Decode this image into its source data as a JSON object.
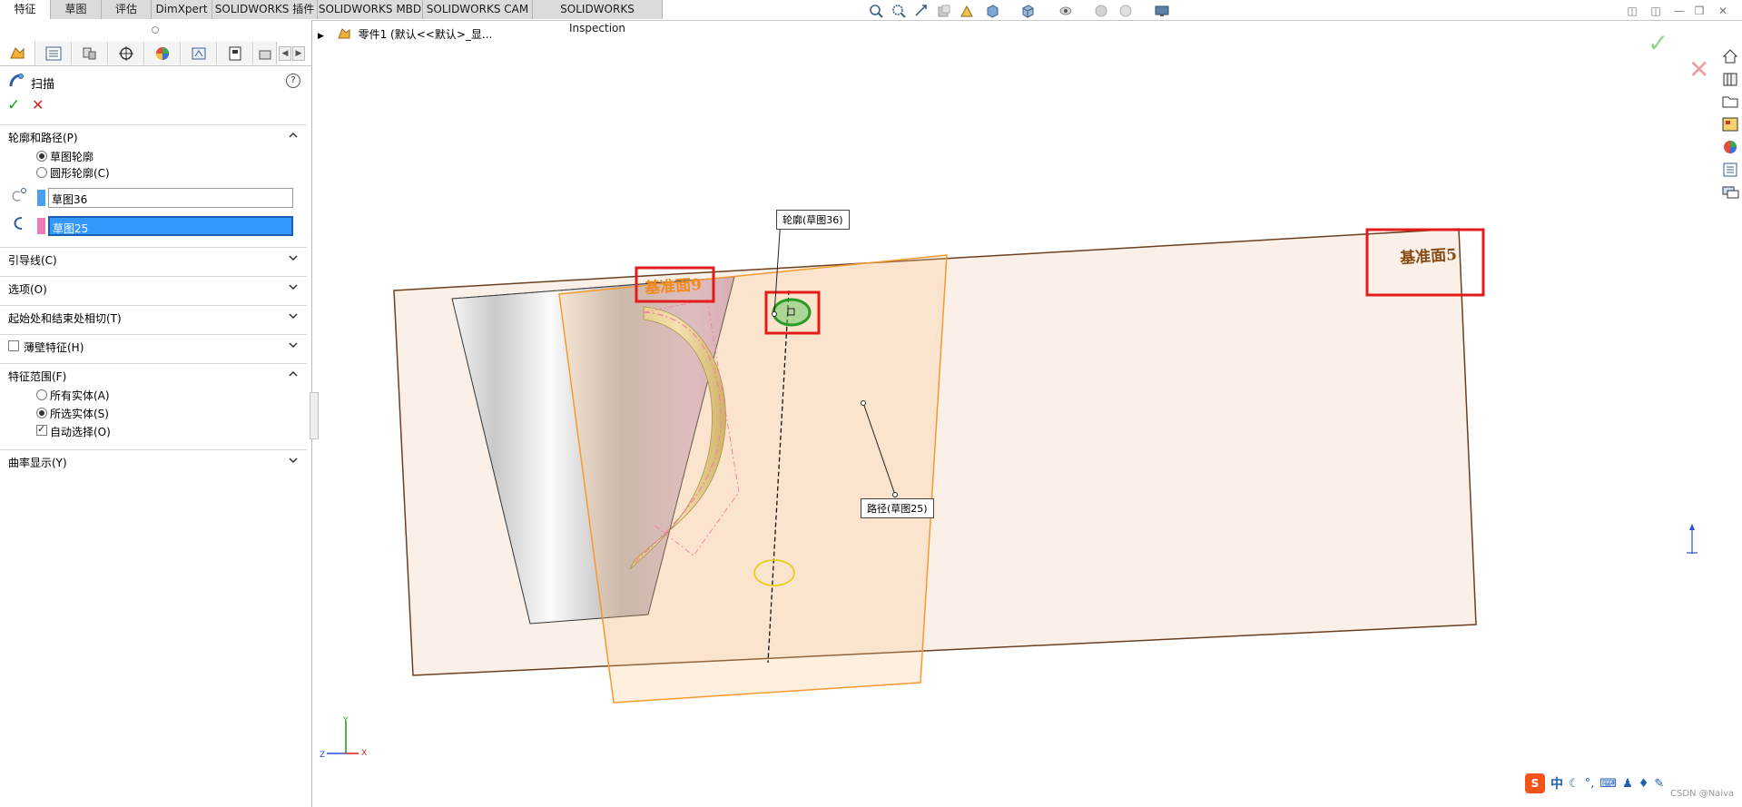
{
  "command_tabs": [
    {
      "label": "特征",
      "active": true
    },
    {
      "label": "草图",
      "active": false
    },
    {
      "label": "评估",
      "active": false
    },
    {
      "label": "DimXpert",
      "active": false
    },
    {
      "label": "SOLIDWORKS 插件",
      "active": false
    },
    {
      "label": "SOLIDWORKS MBD",
      "active": false
    },
    {
      "label": "SOLIDWORKS CAM",
      "active": false
    },
    {
      "label": "SOLIDWORKS Inspection",
      "active": false
    }
  ],
  "property_manager": {
    "feature_name": "扫描",
    "sections": {
      "profile_path": "轮廓和路径(P)",
      "guide_curves": "引导线(C)",
      "options": "选项(O)",
      "start_end_tangency": "起始处和结束处相切(T)",
      "thin_feature": "薄壁特征(H)",
      "feature_scope": "特征范围(F)",
      "curvature_display": "曲率显示(Y)"
    },
    "profile_options": {
      "sketch_profile": "草图轮廓",
      "circular_profile": "圆形轮廓(C)",
      "selected": "sketch_profile"
    },
    "profile_field": "草图36",
    "path_field": "草图25",
    "scope_options": {
      "all_bodies": "所有实体(A)",
      "selected_bodies": "所选实体(S)",
      "auto_select": "自动选择(O)",
      "selected": "selected_bodies",
      "auto_select_checked": true
    },
    "thin_feature_checked": false,
    "colors": {
      "profile_swatch": "#4a9ff0",
      "path_swatch": "#f07ab8",
      "selection_highlight": "#3399ff"
    }
  },
  "viewport": {
    "tree_path": "零件1  (默认<<默认>_显...",
    "callout_profile": "轮廓(草图36)",
    "callout_path": "路径(草图25)",
    "plane_label_left": "基准面9",
    "plane_label_right": "基准面5",
    "triad": {
      "x": "X",
      "y": "Y",
      "z": "Z"
    },
    "colors": {
      "plane_fill": "#f9ece2",
      "plane_edge": "#6b3f1f",
      "selected_plane": "#f5a243",
      "highlight_box": "#e21b1b",
      "path_sketch": "#f06ab4",
      "profile_ring": "#3db33d"
    }
  },
  "ime_tray": {
    "lang": "中"
  },
  "watermark": "CSDN @Naiva"
}
